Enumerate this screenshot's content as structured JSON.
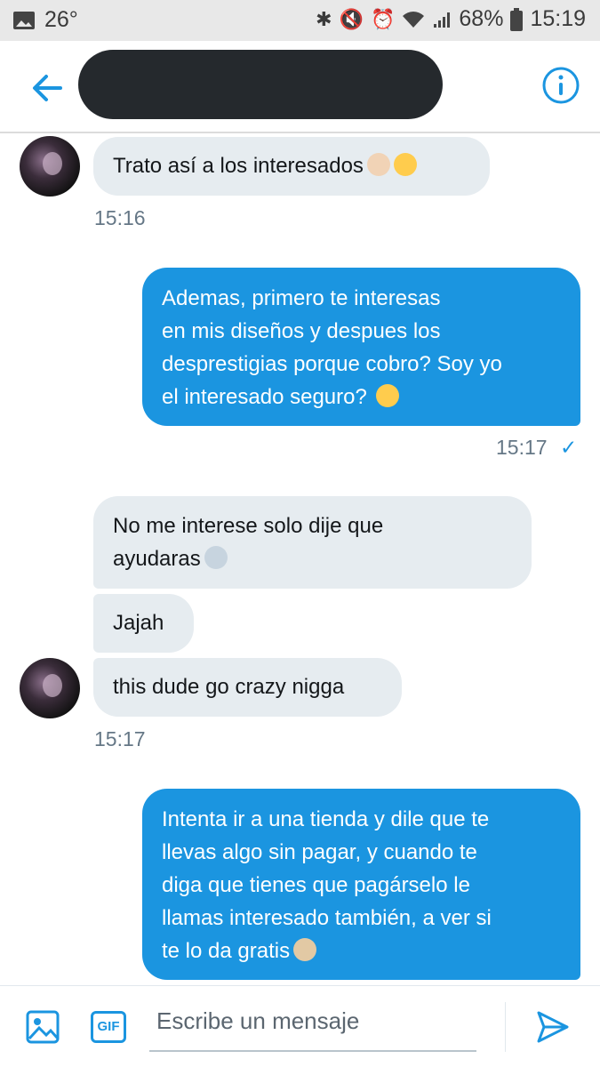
{
  "status_bar": {
    "temperature": "26°",
    "battery": "68%",
    "time": "15:19"
  },
  "header": {
    "back_icon": "arrow-left-icon",
    "info_icon": "info-circle-icon",
    "accent": "#1b95e0",
    "contact_name_redacted": true
  },
  "messages": [
    {
      "direction": "in",
      "text": "Trato así a los interesados",
      "emoji": [
        "ok-hand-emoji",
        "grimacing-face-emoji"
      ]
    },
    {
      "direction": "time",
      "text": "15:16"
    },
    {
      "direction": "out",
      "lines": [
        "Ademas, primero te interesas",
        "en mis diseños y despues los",
        "desprestigias porque cobro? Soy yo",
        "el interesado seguro?"
      ],
      "emoji": [
        "grinning-sweat-emoji"
      ]
    },
    {
      "direction": "time",
      "text": "15:17",
      "check": "✓"
    },
    {
      "direction": "in",
      "lines": [
        "No me interese solo dije que",
        "ayudaras"
      ],
      "emoji": [
        "person-shrugging-emoji"
      ]
    },
    {
      "direction": "in",
      "text": "Jajah"
    },
    {
      "direction": "in",
      "text": "this dude go crazy nigga"
    },
    {
      "direction": "time",
      "text": "15:17"
    },
    {
      "direction": "out",
      "lines": [
        "Intenta ir a una tienda y dile que te",
        "llevas algo sin pagar, y cuando te",
        "diga que tienes que pagárselo le",
        "llamas interesado también, a ver si",
        "te lo da gratis"
      ],
      "emoji": [
        "person-shrugging-emoji"
      ]
    }
  ],
  "composer": {
    "placeholder": "Escribe un mensaje",
    "gif_label": "GIF"
  }
}
